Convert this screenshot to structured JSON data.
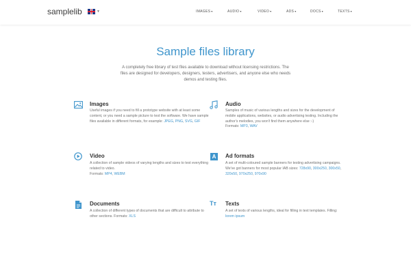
{
  "header": {
    "logo": "samplelib",
    "nav": [
      {
        "label": "IMAGES"
      },
      {
        "label": "AUDIO"
      },
      {
        "label": "VIDEO"
      },
      {
        "label": "ADS"
      },
      {
        "label": "DOCS"
      },
      {
        "label": "TEXTS"
      }
    ]
  },
  "hero": {
    "title": "Sample files library",
    "description": "A completely free library of test files available to download without licensing restrictions. The files are designed for developers, designers, testers, advertisers, and anyone else who needs demos and testing files."
  },
  "sections": {
    "images": {
      "icon": "image-icon",
      "title": "Images",
      "text": "Useful images if you need to fill a prototype website with at least some content, or you need a sample picture to test the software. We have sample files available in different formats, for example: ",
      "links": [
        "JPEG",
        "PNG",
        "SVG",
        "GIF"
      ]
    },
    "audio": {
      "icon": "music-note-icon",
      "title": "Audio",
      "text": "Samples of music of various lengths and sizes for the development of mobile applications, websites, or audio advertising testing. Including the author's melodies, you won't find them anywhere else :-)",
      "formats_label": "Formats: ",
      "links": [
        "MP3",
        "WAV"
      ]
    },
    "video": {
      "icon": "play-circle-icon",
      "title": "Video",
      "text": "A collection of sample videos of varying lengths and sizes to test everything related to video.",
      "formats_label": "Formats: ",
      "links": [
        "MP4",
        "WEBM"
      ]
    },
    "ads": {
      "icon": "ad-icon",
      "icon_letter": "A",
      "title": "Ad formats",
      "text": "A set of multi-coloured sample banners for testing advertising campaigns. We've got banners for most popular IAB sizes: ",
      "links": [
        "728x90",
        "300x250",
        "300x50",
        "320x50",
        "970x250",
        "970x90"
      ]
    },
    "docs": {
      "icon": "document-icon",
      "title": "Documents",
      "text": "A collection of different types of documents that are difficult to attribute to other sections. Formats: ",
      "links": [
        "XLS"
      ]
    },
    "texts": {
      "icon": "text-size-icon",
      "icon_letter": "Tт",
      "title": "Texts",
      "text": "A set of texts of various lengths, ideal for filling in text templates. Filling: ",
      "links": [
        "lorem ipsum"
      ]
    }
  },
  "colors": {
    "accent": "#3f95cc",
    "title": "#333333",
    "body": "#707070"
  }
}
